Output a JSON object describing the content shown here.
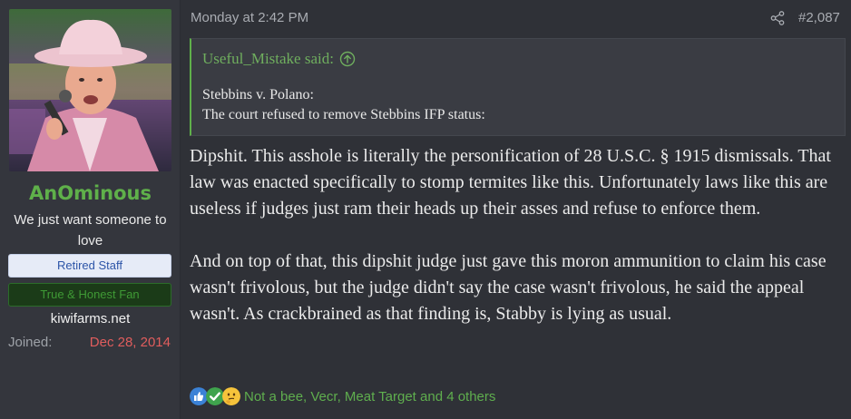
{
  "user": {
    "username": "AnOminous",
    "user_title": "We just want someone to love",
    "banner_staff": "Retired Staff",
    "banner_fan": "True & Honest Fan",
    "site": "kiwifarms.net",
    "joined_label": "Joined:",
    "joined_date": "Dec 28, 2014"
  },
  "post": {
    "date": "Monday at 2:42 PM",
    "number": "#2,087",
    "quote": {
      "author": "Useful_Mistake said:",
      "lines": [
        "Stebbins v. Polano:",
        "The court refused to remove Stebbins IFP status:"
      ]
    },
    "paragraphs": [
      "Dipshit. This asshole is literally the personification of 28 U.S.C. § 1915 dismissals. That law was enacted specifically to stomp termites like this. Unfortunately laws like this are useless if judges just ram their heads up their asses and refuse to enforce them.",
      "And on top of that, this dipshit judge just gave this moron ammunition to claim his case wasn't frivolous, but the judge didn't say the case wasn't frivolous, he said the appeal wasn't. As crackbrained as that finding is, Stabby is lying as usual."
    ],
    "reactions": {
      "icons": [
        "thumbs-up-icon",
        "check-icon",
        "thinking-face-icon"
      ],
      "text": "Not a bee, Vecr, Meat Target and 4 others"
    }
  },
  "colors": {
    "accent_green": "#5fb04a",
    "date_red": "#e05d5d",
    "staff_blue": "#2d55a8"
  }
}
